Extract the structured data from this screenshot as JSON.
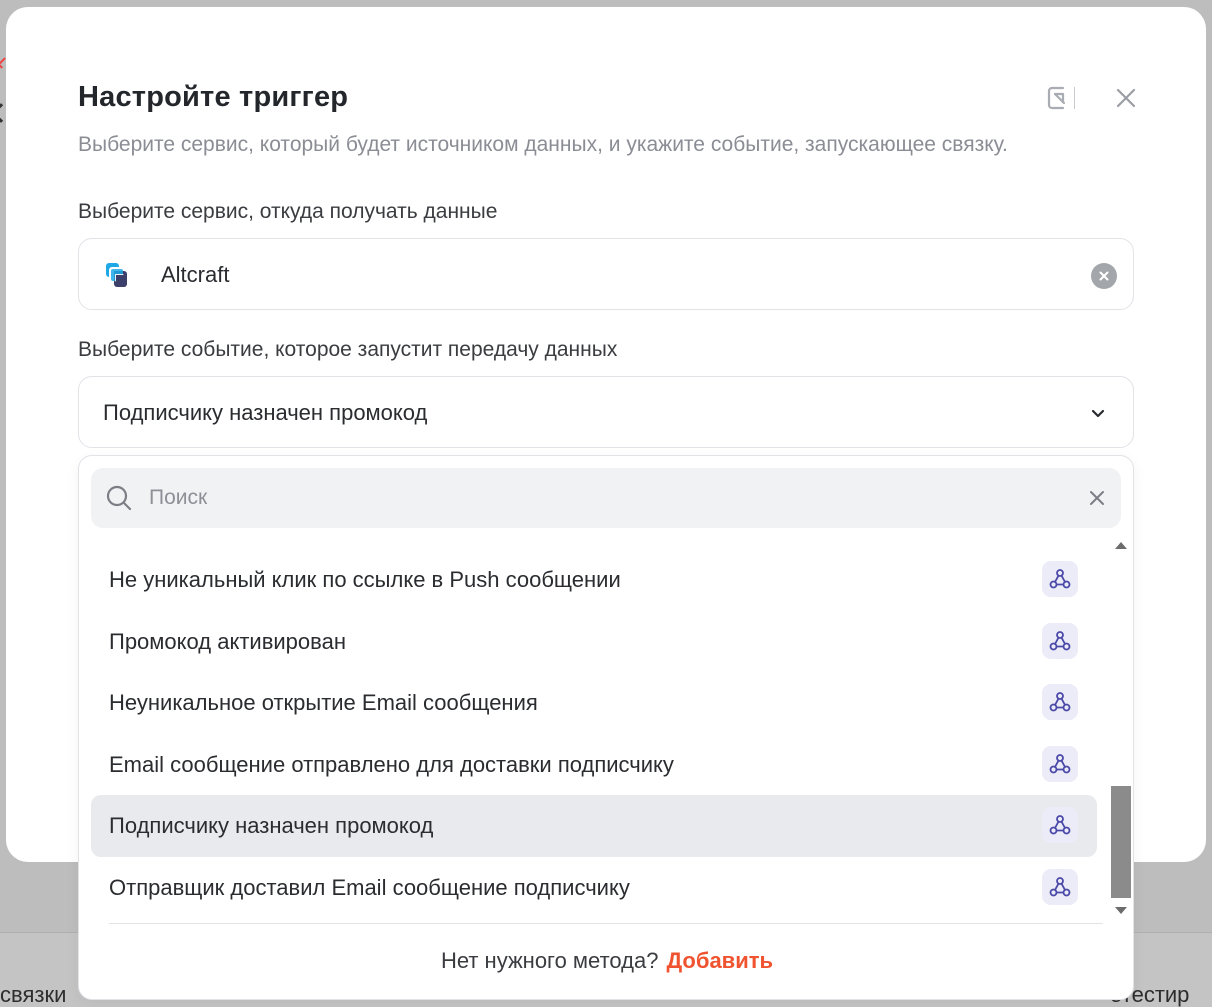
{
  "background": {
    "left_text": "связки",
    "right_text": "отестир"
  },
  "modal": {
    "title": "Настройте триггер",
    "subtitle": "Выберите сервис, который будет источником данных, и укажите событие, запускающее связку.",
    "header_icons": [
      "collapse-arrow-icon",
      "close-icon"
    ]
  },
  "service": {
    "label": "Выберите сервис, откуда получать данные",
    "value": "Altcraft",
    "logo": "altcraft-logo-icon"
  },
  "event": {
    "label": "Выберите событие, которое запустит передачу данных",
    "value": "Подписчику назначен промокод"
  },
  "dropdown": {
    "search_placeholder": "Поиск",
    "search_value": "",
    "items": [
      {
        "label": "Не уникальный клик по ссылке в Push сообщении",
        "selected": false,
        "icon": "webhook-icon"
      },
      {
        "label": "Промокод активирован",
        "selected": false,
        "icon": "webhook-icon"
      },
      {
        "label": "Неуникальное открытие Email сообщения",
        "selected": false,
        "icon": "webhook-icon"
      },
      {
        "label": "Email сообщение отправлено для доставки подписчику",
        "selected": false,
        "icon": "webhook-icon"
      },
      {
        "label": "Подписчику назначен промокод",
        "selected": true,
        "icon": "webhook-icon"
      },
      {
        "label": "Отправщик доставил Email сообщение подписчику",
        "selected": false,
        "icon": "webhook-icon"
      }
    ],
    "footer_text": "Нет нужного метода?",
    "footer_link": "Добавить"
  },
  "colors": {
    "accent_link": "#f0532f",
    "selected_row": "#e9eaed",
    "webhook_badge_bg": "#ececf8",
    "webhook_icon": "#4b49a8"
  }
}
